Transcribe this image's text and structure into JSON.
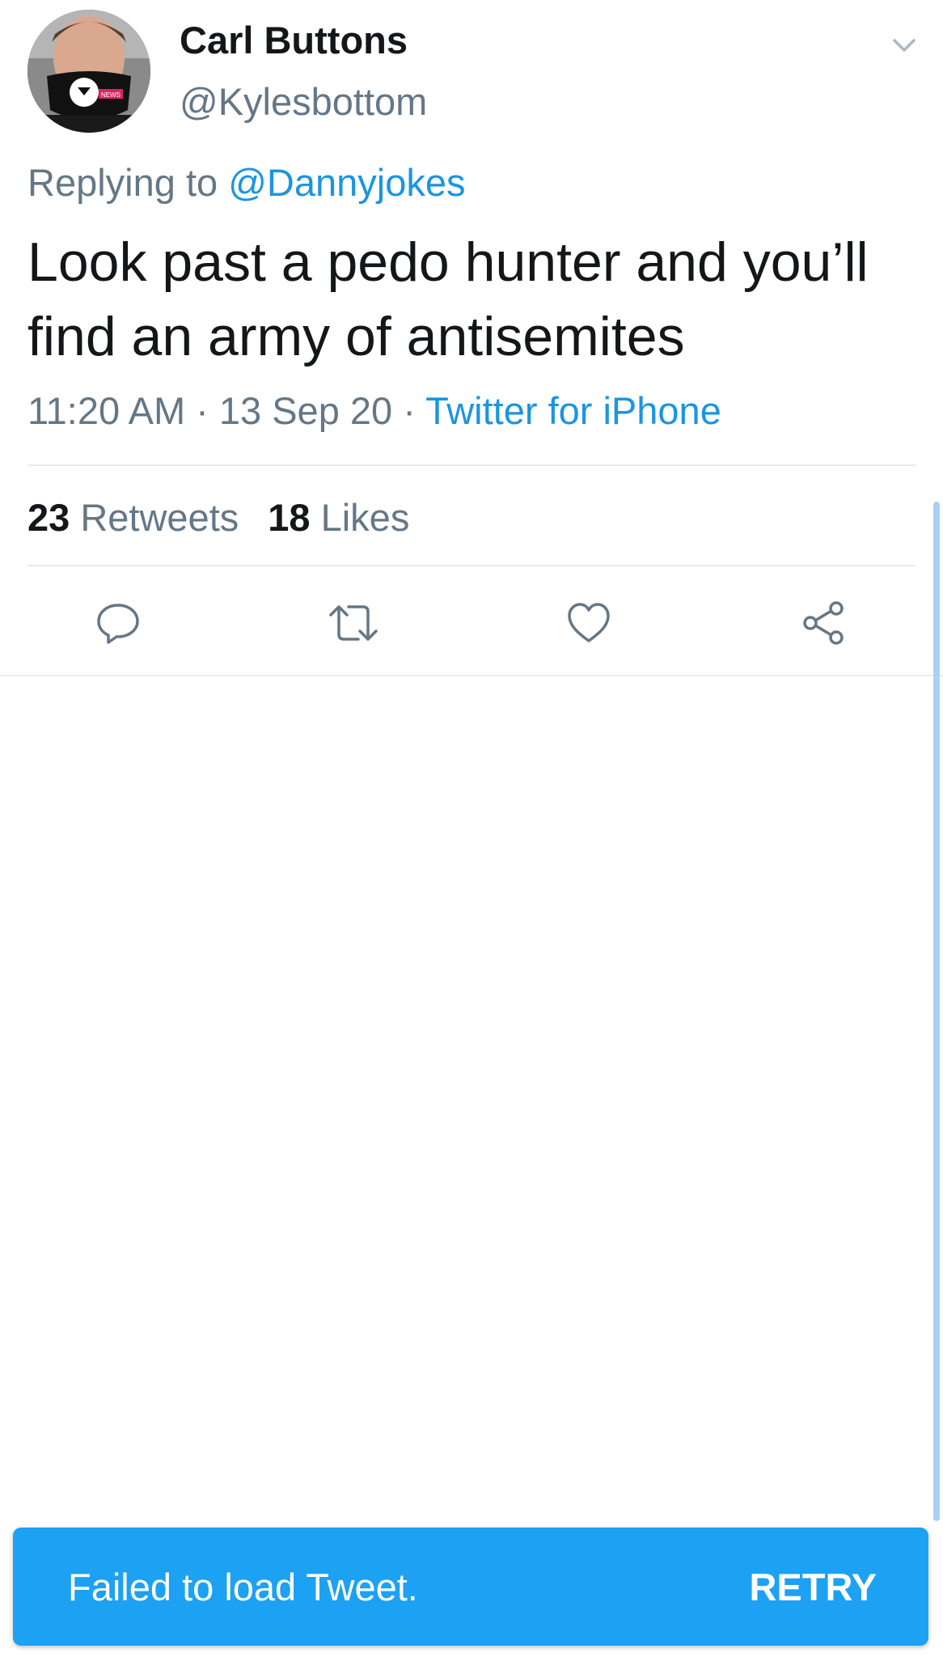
{
  "tweet": {
    "author": {
      "display_name": "Carl Buttons",
      "handle": "@Kylesbottom",
      "avatar_badge": "NEWS"
    },
    "reply": {
      "prefix": "Replying to ",
      "mention": "@Dannyjokes"
    },
    "text": "Look past a pedo hunter and you’ll find an army of antisemites",
    "meta": {
      "time": "11:20 AM",
      "separator": " · ",
      "date": "13 Sep 20",
      "source": "Twitter for iPhone"
    },
    "stats": {
      "retweets_count": "23",
      "retweets_label": " Retweets",
      "likes_count": "18",
      "likes_label": " Likes"
    },
    "actions": [
      {
        "icon": "reply-icon"
      },
      {
        "icon": "retweet-icon"
      },
      {
        "icon": "like-icon"
      },
      {
        "icon": "share-icon"
      }
    ]
  },
  "toast": {
    "message": "Failed to load Tweet.",
    "action_label": "RETRY"
  },
  "colors": {
    "accent": "#1da1f2",
    "link": "#1b95e0",
    "secondary_text": "#657786",
    "primary_text": "#14171a",
    "divider": "#e6ecf0"
  }
}
